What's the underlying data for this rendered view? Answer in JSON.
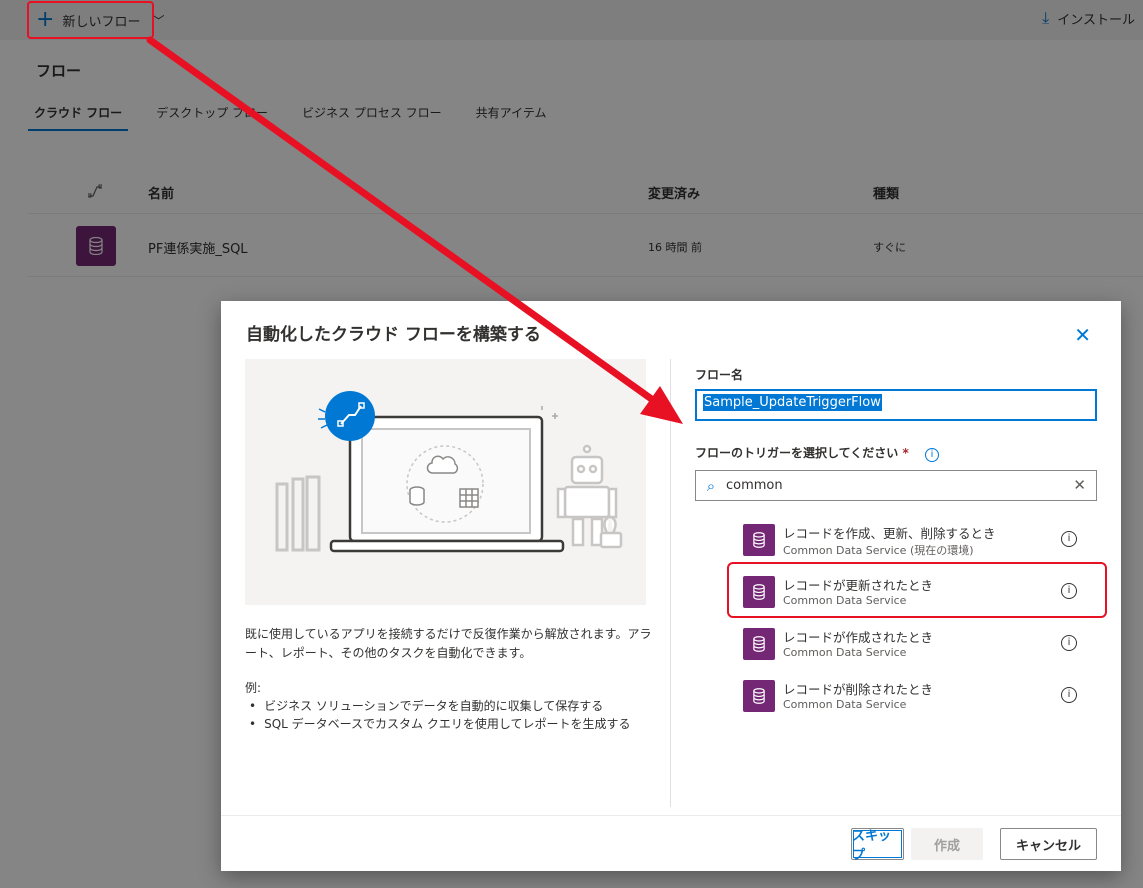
{
  "topbar": {
    "new_flow_label": "新しいフロー",
    "install_label": "インストール"
  },
  "page": {
    "title": "フロー",
    "tabs": [
      {
        "label": "クラウド フロー",
        "active": true
      },
      {
        "label": "デスクトップ フロー",
        "active": false
      },
      {
        "label": "ビジネス プロセス フロー",
        "active": false
      },
      {
        "label": "共有アイテム",
        "active": false
      }
    ],
    "table": {
      "columns": {
        "name": "名前",
        "modified": "変更済み",
        "type": "種類"
      },
      "rows": [
        {
          "name": "PF連係実施_SQL",
          "modified": "16 時間 前",
          "type": "すぐに",
          "icon": "database-icon"
        }
      ]
    }
  },
  "dialog": {
    "title": "自動化したクラウド フローを構築する",
    "description": "既に使用しているアプリを接続するだけで反復作業から解放されます。アラート、レポート、その他のタスクを自動化できます。",
    "examples_label": "例:",
    "examples": [
      "ビジネス ソリューションでデータを自動的に収集して保存する",
      "SQL データベースでカスタム クエリを使用してレポートを生成する"
    ],
    "flow_name_label": "フロー名",
    "flow_name_value": "Sample_UpdateTriggerFlow",
    "trigger_label": "フローのトリガーを選択してください",
    "required_mark": "*",
    "search_value": "common",
    "triggers": [
      {
        "name": "レコードを作成、更新、削除するとき",
        "connector": "Common Data Service (現在の環境)"
      },
      {
        "name": "レコードが更新されたとき",
        "connector": "Common Data Service",
        "highlighted": true
      },
      {
        "name": "レコードが作成されたとき",
        "connector": "Common Data Service"
      },
      {
        "name": "レコードが削除されたとき",
        "connector": "Common Data Service"
      }
    ],
    "buttons": {
      "skip": "スキップ",
      "create": "作成",
      "cancel": "キャンセル"
    }
  },
  "colors": {
    "accent": "#0078d4",
    "dataverse": "#742774",
    "annotation": "#e81123"
  }
}
